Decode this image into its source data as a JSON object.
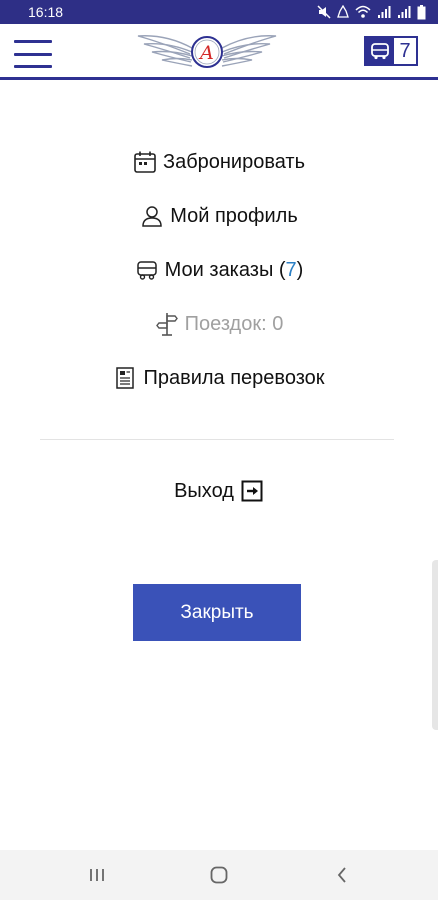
{
  "status_bar": {
    "time": "16:18",
    "icons": [
      "mute-icon",
      "wifi-icon",
      "signal-icon",
      "signal-icon",
      "battery-icon"
    ]
  },
  "header": {
    "logo_letter": "А",
    "orders_count": "7",
    "accent_color": "#2e3192"
  },
  "menu": {
    "book": {
      "label": "Забронировать",
      "icon": "calendar-icon"
    },
    "profile": {
      "label": "Мой профиль",
      "icon": "user-icon"
    },
    "orders": {
      "label": "Мои заказы (",
      "count": "7",
      "suffix": ")",
      "icon": "bus-icon"
    },
    "trips": {
      "label": "Поездок: 0",
      "icon": "signpost-icon"
    },
    "rules": {
      "label": "Правила перевозок",
      "icon": "document-icon"
    }
  },
  "logout": {
    "label": "Выход",
    "icon": "exit-icon"
  },
  "close_button": {
    "label": "Закрыть",
    "color": "#3a52b8"
  },
  "nav_bar": {
    "icons": [
      "recent-apps-icon",
      "home-icon",
      "back-icon"
    ]
  }
}
